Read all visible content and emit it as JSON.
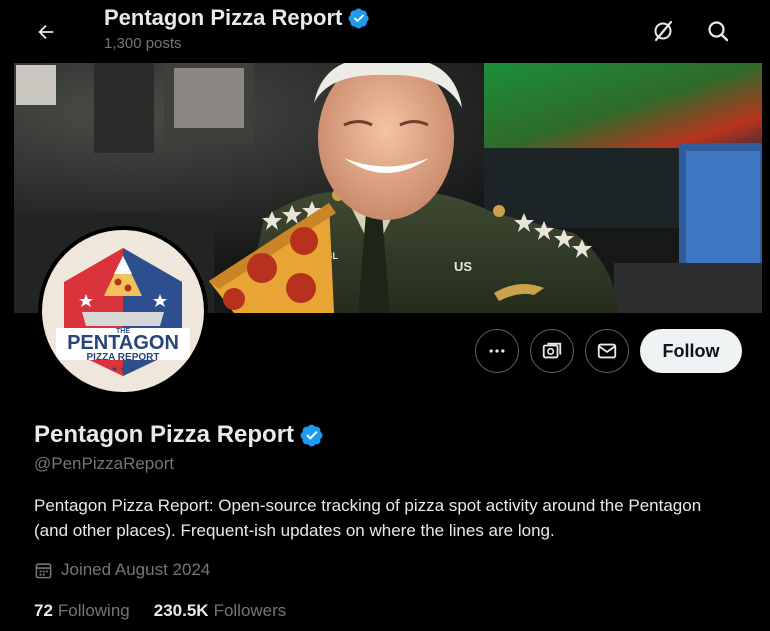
{
  "header": {
    "title": "Pentagon Pizza Report",
    "posts_count": "1,300 posts"
  },
  "icons": {
    "back": "arrow-left-icon",
    "mute": "bell-slash-icon",
    "search": "search-icon",
    "verified": "verified-badge-icon",
    "more": "more-dots-icon",
    "grok": "grok-icon",
    "message": "envelope-icon",
    "calendar": "calendar-icon"
  },
  "avatar": {
    "logo_line1": "THE",
    "logo_line2": "PENTAGON",
    "logo_line3": "PIZZA REPORT"
  },
  "banner": {
    "badge_text": "US",
    "collar_text": "BL"
  },
  "actions": {
    "follow_label": "Follow"
  },
  "profile": {
    "name": "Pentagon Pizza Report",
    "handle": "@PenPizzaReport",
    "bio": "Pentagon Pizza Report: Open-source tracking of pizza spot activity around the Pentagon (and other places). Frequent-ish updates on where the lines are long.",
    "joined": "Joined August 2024"
  },
  "stats": {
    "following_count": "72",
    "following_label": "Following",
    "followers_count": "230.5K",
    "followers_label": "Followers"
  },
  "colors": {
    "background": "#000000",
    "primary_text": "#e7e9ea",
    "secondary_text": "#71767b",
    "verified": "#1d9bf0",
    "follow_bg": "#eff3f4",
    "border": "#536471"
  }
}
